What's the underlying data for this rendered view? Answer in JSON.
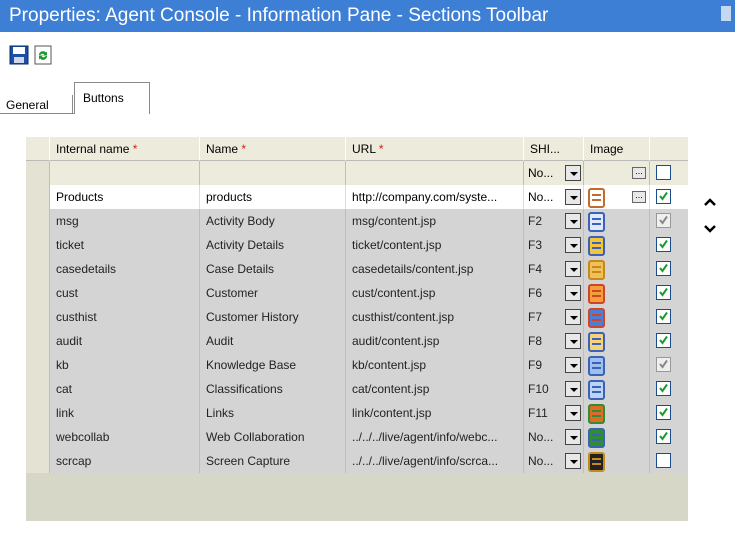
{
  "window": {
    "title": "Properties: Agent Console - Information Pane - Sections Toolbar"
  },
  "toolbar": {
    "save_icon": "save-icon",
    "refresh_icon": "refresh-icon"
  },
  "tabs": [
    {
      "label": "General"
    },
    {
      "label": "Buttons",
      "active": true
    }
  ],
  "table": {
    "headers": {
      "internal_name": "Internal name",
      "name": "Name",
      "url": "URL",
      "shortcut": "SHI...",
      "image": "Image"
    },
    "required_marker": "*",
    "new_row": {
      "shortcut": "No..."
    },
    "rows": [
      {
        "internal": "Products",
        "name": "products",
        "url": "http://company.com/syste...",
        "shortcut": "No...",
        "icon": "lines-icon",
        "checked": true,
        "editable": true
      },
      {
        "internal": "msg",
        "name": "Activity Body",
        "url": "msg/content.jsp",
        "shortcut": "F2",
        "icon": "document-icon",
        "checked": true,
        "disabled": true
      },
      {
        "internal": "ticket",
        "name": "Activity Details",
        "url": "ticket/content.jsp",
        "shortcut": "F3",
        "icon": "ticket-details-icon",
        "checked": true
      },
      {
        "internal": "casedetails",
        "name": "Case Details",
        "url": "casedetails/content.jsp",
        "shortcut": "F4",
        "icon": "case-briefcase-icon",
        "checked": true
      },
      {
        "internal": "cust",
        "name": "Customer",
        "url": "cust/content.jsp",
        "shortcut": "F6",
        "icon": "customer-icon",
        "checked": true
      },
      {
        "internal": "custhist",
        "name": "Customer History",
        "url": "custhist/content.jsp",
        "shortcut": "F7",
        "icon": "customer-history-icon",
        "checked": true
      },
      {
        "internal": "audit",
        "name": "Audit",
        "url": "audit/content.jsp",
        "shortcut": "F8",
        "icon": "audit-icon",
        "checked": true
      },
      {
        "internal": "kb",
        "name": "Knowledge Base",
        "url": "kb/content.jsp",
        "shortcut": "F9",
        "icon": "book-icon",
        "checked": true,
        "disabled": true
      },
      {
        "internal": "cat",
        "name": "Classifications",
        "url": "cat/content.jsp",
        "shortcut": "F10",
        "icon": "classification-icon",
        "checked": true
      },
      {
        "internal": "link",
        "name": "Links",
        "url": "link/content.jsp",
        "shortcut": "F11",
        "icon": "links-tree-icon",
        "checked": true
      },
      {
        "internal": "webcollab",
        "name": "Web Collaboration",
        "url": "../../../live/agent/info/webc...",
        "shortcut": "No...",
        "icon": "web-collab-icon",
        "checked": true
      },
      {
        "internal": "scrcap",
        "name": "Screen Capture",
        "url": "../../../live/agent/info/scrca...",
        "shortcut": "No...",
        "icon": "screen-capture-icon",
        "checked": false
      }
    ]
  },
  "side_buttons": {
    "up": "move-up-icon",
    "down": "move-down-icon"
  }
}
